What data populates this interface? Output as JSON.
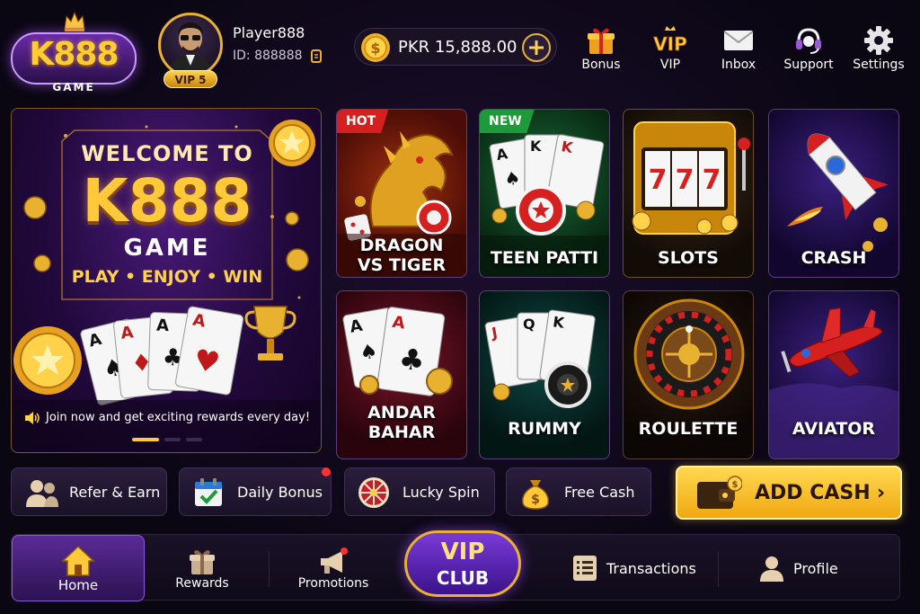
{
  "header": {
    "logo": {
      "brand": "K888",
      "sub": "GAME"
    },
    "player": {
      "name": "Player888",
      "id": "ID: 888888",
      "vip": "VIP 5"
    },
    "balance": {
      "amount": "PKR 15,888.00"
    },
    "nav": [
      {
        "label": "Bonus",
        "icon": "gift-icon"
      },
      {
        "label": "VIP",
        "icon": "vip-icon"
      },
      {
        "label": "Inbox",
        "icon": "mail-icon"
      },
      {
        "label": "Support",
        "icon": "headset-icon"
      },
      {
        "label": "Settings",
        "icon": "gear-icon"
      }
    ]
  },
  "banner": {
    "welcome": "WELCOME TO",
    "brand": "K888",
    "game": "GAME",
    "tagline": "PLAY • ENJOY • WIN",
    "note": "Join now and get exciting rewards every day!",
    "slides": 3,
    "active_slide": 0
  },
  "games": [
    {
      "name_line1": "DRAGON",
      "name_line2": "VS TIGER",
      "ribbon": "HOT",
      "ribbon_color": "#d62020"
    },
    {
      "name_line1": "TEEN PATTI",
      "name_line2": "",
      "ribbon": "NEW",
      "ribbon_color": "#1f9a3a"
    },
    {
      "name_line1": "SLOTS",
      "name_line2": "",
      "ribbon": ""
    },
    {
      "name_line1": "CRASH",
      "name_line2": "",
      "ribbon": ""
    },
    {
      "name_line1": "ANDAR",
      "name_line2": "BAHAR",
      "ribbon": ""
    },
    {
      "name_line1": "RUMMY",
      "name_line2": "",
      "ribbon": ""
    },
    {
      "name_line1": "ROULETTE",
      "name_line2": "",
      "ribbon": ""
    },
    {
      "name_line1": "AVIATOR",
      "name_line2": "",
      "ribbon": ""
    }
  ],
  "actions": [
    {
      "label": "Refer & Earn",
      "icon": "users-icon"
    },
    {
      "label": "Daily Bonus",
      "icon": "calendar-check-icon"
    },
    {
      "label": "Lucky Spin",
      "icon": "wheel-icon"
    },
    {
      "label": "Free Cash",
      "icon": "money-bag-icon"
    }
  ],
  "add_cash": {
    "label": "ADD CASH"
  },
  "bottom_nav": {
    "home": "Home",
    "rewards": "Rewards",
    "promotions": "Promotions",
    "vip_line1": "VIP",
    "vip_line2": "CLUB",
    "transactions": "Transactions",
    "profile": "Profile"
  },
  "colors": {
    "gold": "#ffc93a",
    "purple": "#5a2a98",
    "background": "#0a0612",
    "notification": "#ff3030"
  }
}
